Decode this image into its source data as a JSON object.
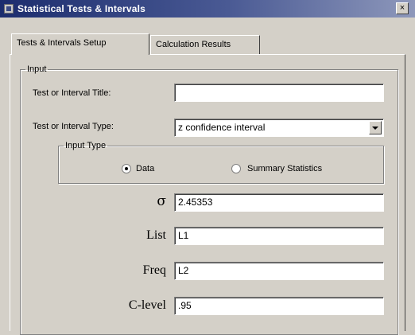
{
  "window": {
    "title": "Statistical Tests & Intervals",
    "close_glyph": "×"
  },
  "tabs": [
    {
      "label": "Tests & Intervals Setup",
      "active": true
    },
    {
      "label": "Calculation Results",
      "active": false
    }
  ],
  "input_group": {
    "legend": "Input",
    "title_label": "Test or Interval Title:",
    "title_value": "",
    "type_label": "Test or Interval Type:",
    "type_value": "z confidence interval"
  },
  "input_type": {
    "legend": "Input Type",
    "options": [
      {
        "label": "Data",
        "checked": true
      },
      {
        "label": "Summary Statistics",
        "checked": false
      }
    ]
  },
  "params": {
    "sigma_label": "σ",
    "sigma_value": "2.45353",
    "list_label": "List",
    "list_value": "L1",
    "freq_label": "Freq",
    "freq_value": "L2",
    "clevel_label": "C-level",
    "clevel_value": ".95"
  }
}
